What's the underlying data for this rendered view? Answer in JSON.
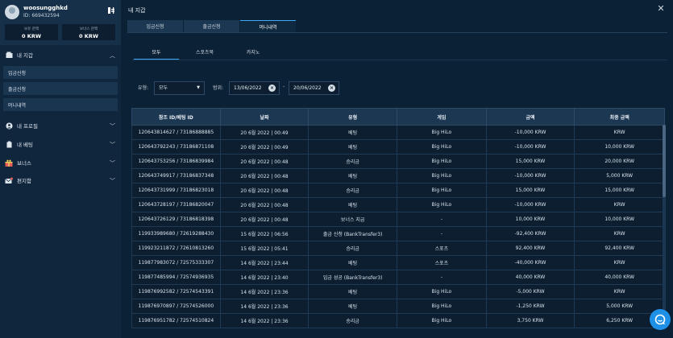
{
  "user": {
    "name": "woosungghkd",
    "id": "ID: 669432594"
  },
  "balances": [
    {
      "label": "보유 잔액",
      "value": "0 KRW"
    },
    {
      "label": "보너스 잔액",
      "value": "0 KRW"
    }
  ],
  "sidebar": {
    "items": [
      {
        "label": "내 지갑"
      },
      {
        "label": "내 프로필"
      },
      {
        "label": "내 베팅"
      },
      {
        "label": "보너스"
      },
      {
        "label": "편지함"
      }
    ],
    "wallet_sub": [
      "입금신청",
      "출금신청",
      "머니내역"
    ]
  },
  "header": {
    "title": "내 지갑"
  },
  "tabs": [
    "입금신청",
    "출금신청",
    "머니내역"
  ],
  "subtabs": [
    "모두",
    "스포츠북",
    "카지노"
  ],
  "filter": {
    "type_label": "유형:",
    "type_value": "모두",
    "range_label": "범위:",
    "date_from": "13/06/2022",
    "date_to": "20/06/2022",
    "dash": "-"
  },
  "table": {
    "headers": [
      "참조 ID/베팅 ID",
      "날짜",
      "유형",
      "게임",
      "금액",
      "최종 금액"
    ],
    "rows": [
      [
        "120643814627 / 73186888885",
        "20 6월 2022 | 00:49",
        "베팅",
        "Big HiLo",
        "-10,000 KRW",
        "KRW"
      ],
      [
        "120643792243 / 73186871108",
        "20 6월 2022 | 00:49",
        "베팅",
        "Big HiLo",
        "-10,000 KRW",
        "10,000 KRW"
      ],
      [
        "120643753256 / 73186839984",
        "20 6월 2022 | 00:48",
        "승리금",
        "Big HiLo",
        "15,000 KRW",
        "20,000 KRW"
      ],
      [
        "120643749917 / 73186837348",
        "20 6월 2022 | 00:48",
        "베팅",
        "Big HiLo",
        "-10,000 KRW",
        "5,000 KRW"
      ],
      [
        "120643731999 / 73186823018",
        "20 6월 2022 | 00:48",
        "승리금",
        "Big HiLo",
        "15,000 KRW",
        "15,000 KRW"
      ],
      [
        "120643728197 / 73186820047",
        "20 6월 2022 | 00:48",
        "베팅",
        "Big HiLo",
        "-10,000 KRW",
        "KRW"
      ],
      [
        "120643726129 / 73186818398",
        "20 6월 2022 | 00:48",
        "보너스 지급",
        "-",
        "10,000 KRW",
        "10,000 KRW"
      ],
      [
        "119933989680 / 72619288430",
        "15 6월 2022 | 06:56",
        "출금 신청 (BankTransfer3)",
        "-",
        "-92,400 KRW",
        "KRW"
      ],
      [
        "119923211872 / 72610813260",
        "15 6월 2022 | 05:41",
        "승리금",
        "스포츠",
        "92,400 KRW",
        "92,400 KRW"
      ],
      [
        "119877983072 / 72575333307",
        "14 6월 2022 | 23:44",
        "베팅",
        "스포츠",
        "-40,000 KRW",
        "KRW"
      ],
      [
        "119877485994 / 72574936935",
        "14 6월 2022 | 23:40",
        "입금 성공 (BankTransfer3)",
        "-",
        "40,000 KRW",
        "40,000 KRW"
      ],
      [
        "119876992582 / 72574543391",
        "14 6월 2022 | 23:36",
        "베팅",
        "Big HiLo",
        "-5,000 KRW",
        "KRW"
      ],
      [
        "119876970897 / 72574526000",
        "14 6월 2022 | 23:36",
        "베팅",
        "Big HiLo",
        "-1,250 KRW",
        "5,000 KRW"
      ],
      [
        "119876951782 / 72574510824",
        "14 6월 2022 | 23:36",
        "승리금",
        "Big HiLo",
        "3,750 KRW",
        "6,250 KRW"
      ]
    ]
  },
  "icons": {
    "close": "close-icon",
    "chat": "chat-support-icon",
    "wallet": "wallet-icon"
  },
  "colors": {
    "accent": "#3fa9f5",
    "chat": "#1e90e8",
    "background": "#0b2136"
  }
}
